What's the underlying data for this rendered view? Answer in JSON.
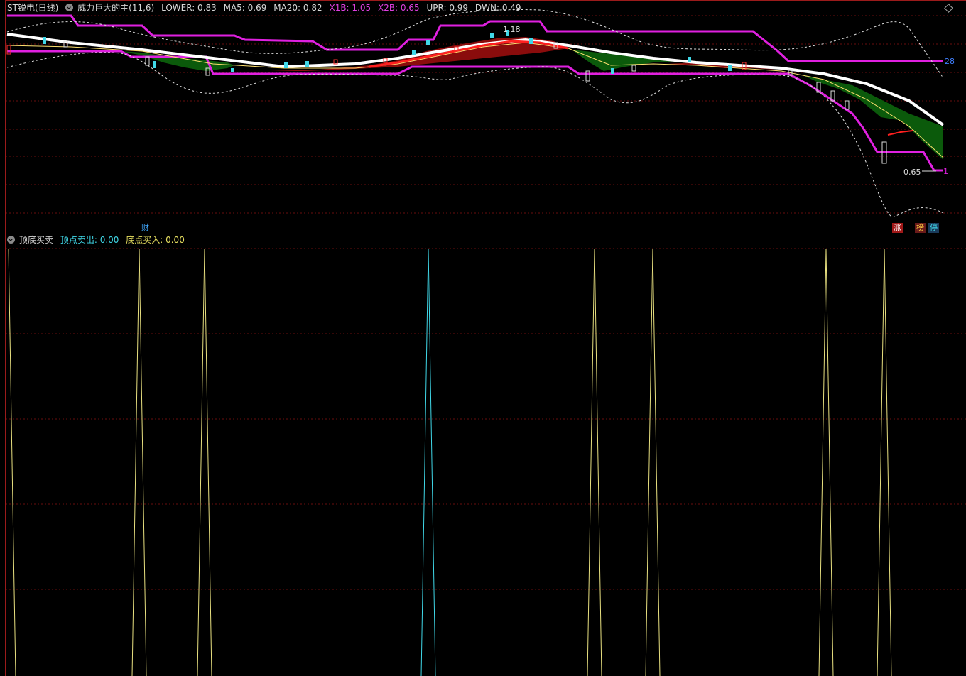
{
  "top_panel": {
    "stock_name": "ST锐电",
    "period": "(日线)",
    "indicator": "威力巨大的主(11,6)",
    "lower": "LOWER: 0.83",
    "ma5": "MA5: 0.69",
    "ma20": "MA20: 0.82",
    "x1b": "X1B: 1.05",
    "x2b": "X2B: 0.65",
    "upr": "UPR: 0.99",
    "dwn": "DWN: 0.49",
    "high_label": "1.18",
    "low_label": "0.65",
    "right_level_label": "28",
    "right_bottom_label": "1"
  },
  "bottom_panel": {
    "name": "顶底买卖",
    "sell": "顶点卖出: 0.00",
    "buy": "底点买入: 0.00"
  },
  "markers": {
    "cai": "财",
    "zhang": "涨",
    "bang": "榜",
    "ting": "停"
  },
  "colors": {
    "background": "#000000",
    "grid": "#7a1010",
    "magenta_line": "#e020e0",
    "white_ma": "#ffffff",
    "red_fill": "#8a0c0c",
    "green_fill": "#0b5a0b",
    "yellow_signal": "#e8e080",
    "cyan_signal": "#40d8e8"
  },
  "icons": {
    "panel_toggle": "chevron-down-icon",
    "diamond": "diamond-icon"
  }
}
